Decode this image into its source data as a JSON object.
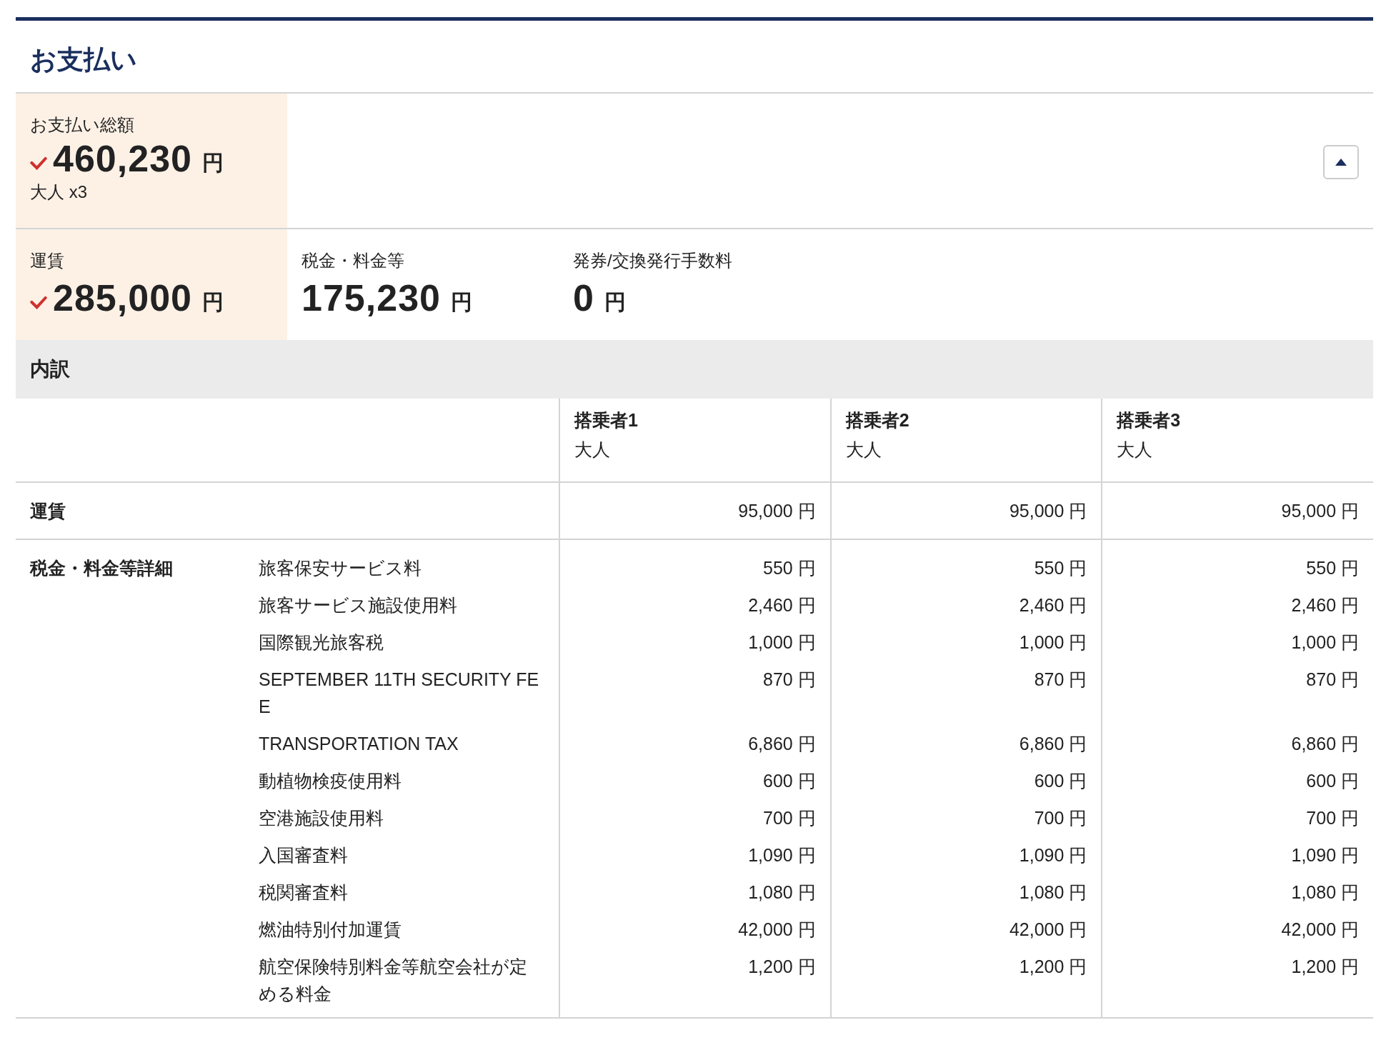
{
  "title": "お支払い",
  "total": {
    "label": "お支払い総額",
    "amount": "460,230",
    "currency": "円",
    "passengers": "大人 x3",
    "checked": true
  },
  "collapse_button": {
    "expanded": true
  },
  "fees": [
    {
      "label": "運賃",
      "amount": "285,000",
      "currency": "円",
      "checked": true
    },
    {
      "label": "税金・料金等",
      "amount": "175,230",
      "currency": "円",
      "checked": false
    },
    {
      "label": "発券/交換発行手数料",
      "amount": "0",
      "currency": "円",
      "checked": false
    }
  ],
  "breakdown": {
    "title": "内訳",
    "passengers": [
      {
        "name": "搭乗者1",
        "type": "大人"
      },
      {
        "name": "搭乗者2",
        "type": "大人"
      },
      {
        "name": "搭乗者3",
        "type": "大人"
      }
    ],
    "fare": {
      "label": "運賃",
      "values": [
        "95,000 円",
        "95,000 円",
        "95,000 円"
      ]
    },
    "taxes": {
      "label": "税金・料金等詳細",
      "items": [
        {
          "name": "旅客保安サービス料",
          "values": [
            "550 円",
            "550 円",
            "550 円"
          ]
        },
        {
          "name": "旅客サービス施設使用料",
          "values": [
            "2,460 円",
            "2,460 円",
            "2,460 円"
          ]
        },
        {
          "name": "国際観光旅客税",
          "values": [
            "1,000 円",
            "1,000 円",
            "1,000 円"
          ]
        },
        {
          "name": "SEPTEMBER 11TH SECURITY FEE",
          "values": [
            "870 円",
            "870 円",
            "870 円"
          ]
        },
        {
          "name": "TRANSPORTATION TAX",
          "values": [
            "6,860 円",
            "6,860 円",
            "6,860 円"
          ]
        },
        {
          "name": "動植物検疫使用料",
          "values": [
            "600 円",
            "600 円",
            "600 円"
          ]
        },
        {
          "name": "空港施設使用料",
          "values": [
            "700 円",
            "700 円",
            "700 円"
          ]
        },
        {
          "name": "入国審査料",
          "values": [
            "1,090 円",
            "1,090 円",
            "1,090 円"
          ]
        },
        {
          "name": "税関審査料",
          "values": [
            "1,080 円",
            "1,080 円",
            "1,080 円"
          ]
        },
        {
          "name": "燃油特別付加運賃",
          "values": [
            "42,000 円",
            "42,000 円",
            "42,000 円"
          ]
        },
        {
          "name": "航空保険特別料金等航空会社が定める料金",
          "values": [
            "1,200 円",
            "1,200 円",
            "1,200 円"
          ]
        }
      ]
    }
  }
}
